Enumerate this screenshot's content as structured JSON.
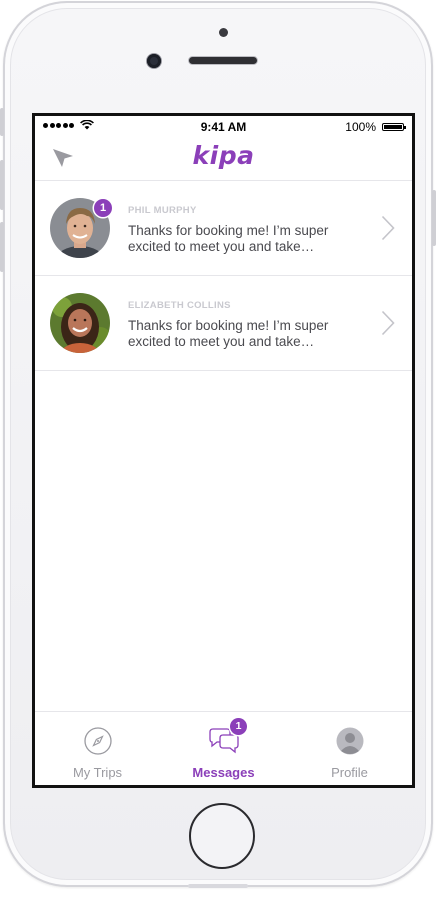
{
  "status_bar": {
    "time": "9:41 AM",
    "battery_percent": "100%"
  },
  "nav": {
    "logo": "kipa",
    "left_icon": "location-arrow-icon"
  },
  "messages": [
    {
      "sender": "PHIL MURPHY",
      "preview": "Thanks for booking me! I’m super excited to meet you and take…",
      "unread_count": "1"
    },
    {
      "sender": "ELIZABETH COLLINS",
      "preview": "Thanks for booking me! I’m super excited to meet you and take…"
    }
  ],
  "tab_bar": {
    "tabs": [
      {
        "label": "My Trips",
        "icon": "compass-icon",
        "active": false
      },
      {
        "label": "Messages",
        "icon": "chat-bubbles-icon",
        "active": true,
        "badge": "1"
      },
      {
        "label": "Profile",
        "icon": "user-icon",
        "active": false
      }
    ]
  },
  "colors": {
    "brand": "#8b3fb9",
    "inactive_tab": "#9a9aa0",
    "sender_name": "#c9c9cf",
    "preview_text": "#4a4a4f"
  }
}
